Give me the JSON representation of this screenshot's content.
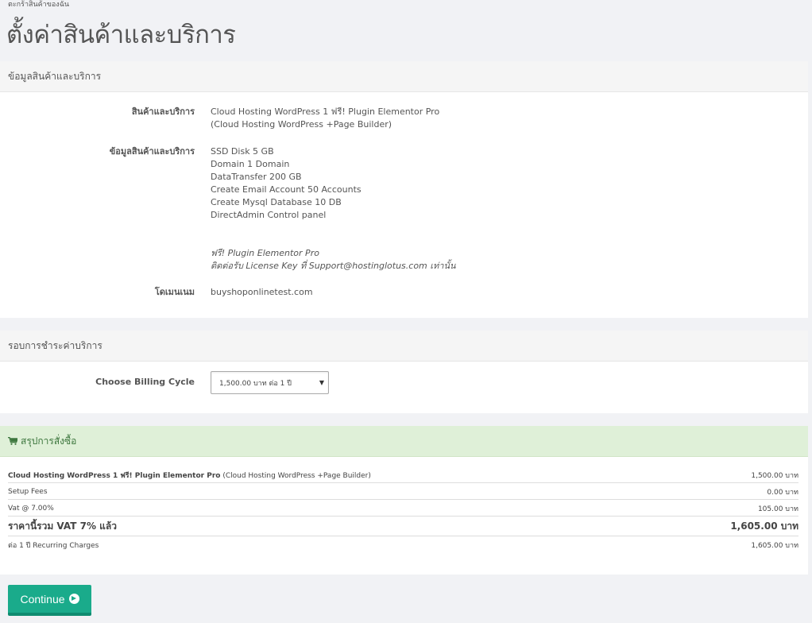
{
  "breadcrumb": "ตะกร้าสินค้าของฉัน",
  "page_title": "ตั้งค่าสินค้าและบริการ",
  "product_section": {
    "heading": "ข้อมูลสินค้าและบริการ",
    "product_label": "สินค้าและบริการ",
    "product_name": "Cloud Hosting WordPress 1 ฟรี! Plugin Elementor Pro",
    "product_group": "(Cloud Hosting WordPress +Page Builder)",
    "info_label": "ข้อมูลสินค้าและบริการ",
    "info_lines": [
      "SSD Disk 5 GB",
      "Domain 1 Domain",
      "DataTransfer 200 GB",
      "Create Email Account 50 Accounts",
      "Create Mysql Database 10 DB",
      "DirectAdmin Control panel"
    ],
    "promo_lines": [
      "ฟรี! Plugin Elementor Pro",
      "ติดต่อรับ License Key ที่ Support@hostinglotus.com เท่านั้น"
    ],
    "domain_label": "โดเมนเนม",
    "domain_value": "buyshoponlinetest.com"
  },
  "billing_section": {
    "heading": "รอบการชำระค่าบริการ",
    "cycle_label": "Choose Billing Cycle",
    "cycle_selected": "1,500.00 บาท ต่อ 1 ปี"
  },
  "summary": {
    "heading": "สรุปการสั่งซื้อ",
    "product_name": "Cloud Hosting WordPress 1 ฟรี! Plugin Elementor Pro",
    "product_group": "(Cloud Hosting WordPress +Page Builder)",
    "product_price": "1,500.00 บาท",
    "setup_label": "Setup Fees",
    "setup_price": "0.00 บาท",
    "vat_label": "Vat @ 7.00%",
    "vat_price": "105.00 บาท",
    "total_label": "ราคานี้รวม VAT 7% แล้ว",
    "total_price": "1,605.00 บาท",
    "recurring_label": "ต่อ 1 ปี Recurring Charges",
    "recurring_price": "1,605.00 บาท"
  },
  "continue_label": "Continue",
  "colors": {
    "accent": "#1aab8b",
    "summary_heading_bg": "#dff0d8",
    "summary_heading_text": "#3c763d"
  }
}
